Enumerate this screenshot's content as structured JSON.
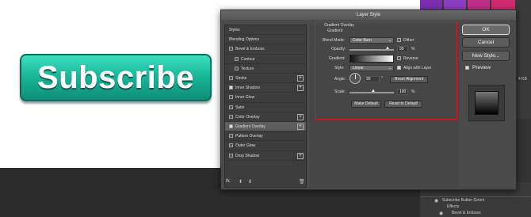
{
  "subscribe_button": {
    "label": "Subscribe",
    "color": "#1ab89a"
  },
  "dialog": {
    "title": "Layer Style",
    "styles_header": "Styles",
    "list": [
      {
        "label": "Blending Options",
        "checkbox": false,
        "checked": false,
        "plus": false,
        "indent": false
      },
      {
        "label": "Bevel & Emboss",
        "checkbox": true,
        "checked": false,
        "plus": false,
        "indent": false
      },
      {
        "label": "Contour",
        "checkbox": true,
        "checked": false,
        "plus": false,
        "indent": true
      },
      {
        "label": "Texture",
        "checkbox": true,
        "checked": false,
        "plus": false,
        "indent": true
      },
      {
        "label": "Stroke",
        "checkbox": true,
        "checked": false,
        "plus": true,
        "indent": false
      },
      {
        "label": "Inner Shadow",
        "checkbox": true,
        "checked": true,
        "plus": true,
        "indent": false
      },
      {
        "label": "Inner Glow",
        "checkbox": true,
        "checked": false,
        "plus": false,
        "indent": false
      },
      {
        "label": "Satin",
        "checkbox": true,
        "checked": false,
        "plus": false,
        "indent": false
      },
      {
        "label": "Color Overlay",
        "checkbox": true,
        "checked": false,
        "plus": true,
        "indent": false
      },
      {
        "label": "Gradient Overlay",
        "checkbox": true,
        "checked": true,
        "plus": true,
        "indent": false,
        "selected": true
      },
      {
        "label": "Pattern Overlay",
        "checkbox": true,
        "checked": false,
        "plus": false,
        "indent": false
      },
      {
        "label": "Outer Glow",
        "checkbox": true,
        "checked": false,
        "plus": false,
        "indent": false
      },
      {
        "label": "Drop Shadow",
        "checkbox": true,
        "checked": false,
        "plus": true,
        "indent": false
      }
    ],
    "fx_label": "fx.",
    "section_title": "Gradient Overlay",
    "subsection_title": "Gradient",
    "blend_mode_label": "Blend Mode:",
    "blend_mode_value": "Color Burn",
    "dither_label": "Dither",
    "opacity_label": "Opacity:",
    "opacity_value": "90",
    "percent": "%",
    "gradient_label": "Gradient:",
    "reverse_label": "Reverse",
    "style_label": "Style:",
    "style_value": "Linear",
    "align_label": "Align with Layer",
    "angle_label": "Angle:",
    "angle_value": "90",
    "degree": "°",
    "reset_alignment": "Reset Alignment",
    "scale_label": "Scale:",
    "scale_value": "100",
    "make_default": "Make Default",
    "reset_default": "Reset to Default",
    "ok": "OK",
    "cancel": "Cancel",
    "new_style": "New Style...",
    "preview_label": "Preview"
  },
  "layers_panel": {
    "size_text": "4 KB",
    "rows": [
      "Subscribe Button Green",
      "Effects",
      "Bevel & Emboss"
    ]
  }
}
